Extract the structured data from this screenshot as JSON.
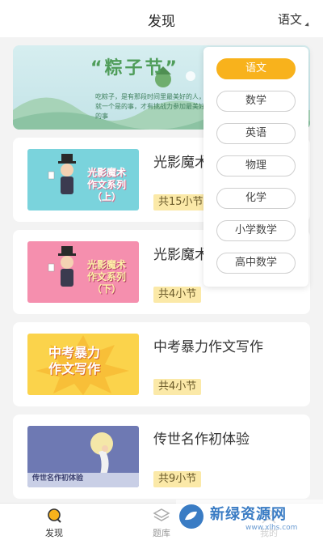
{
  "header": {
    "title": "发现",
    "subject_selected": "语文"
  },
  "banner": {
    "title": "“粽子节”",
    "subtitle": "吃粽子，是有那段时间里最美好的人，就一个是的事，才有挑战力参加最美好的事"
  },
  "courses": [
    {
      "title": "光影魔术作文系列（上）",
      "thumb_text_1": "光影魔术",
      "thumb_text_2": "作文系列",
      "thumb_text_3": "（上）",
      "lessons": "共15小节",
      "thumb_color": "#7ad3dc"
    },
    {
      "title": "光影魔术作文系列（下）",
      "thumb_text_1": "光影魔术",
      "thumb_text_2": "作文系列",
      "thumb_text_3": "（下）",
      "lessons": "共4小节",
      "thumb_color": "#f58fae"
    },
    {
      "title": "中考暴力作文写作",
      "thumb_text_1": "中考暴力",
      "thumb_text_2": "作文写作",
      "thumb_text_3": "",
      "lessons": "共4小节",
      "thumb_color": "#fbd34b"
    },
    {
      "title": "传世名作初体验",
      "thumb_text_1": "传世名作初体验",
      "thumb_text_2": "",
      "thumb_text_3": "",
      "lessons": "共9小节",
      "thumb_color": "#6e79b3"
    }
  ],
  "dropdown": {
    "items": [
      "语文",
      "数学",
      "英语",
      "物理",
      "化学",
      "小学数学",
      "高中数学"
    ],
    "active_index": 0
  },
  "tabbar": {
    "tabs": [
      "发现",
      "题库",
      "我的"
    ],
    "active_index": 0
  },
  "watermark": {
    "text": "新绿资源网",
    "url": "www.xlhs.com"
  },
  "colors": {
    "accent": "#f8b21c",
    "badge_bg": "#fbe9a8",
    "watermark": "#3a7cc4"
  }
}
